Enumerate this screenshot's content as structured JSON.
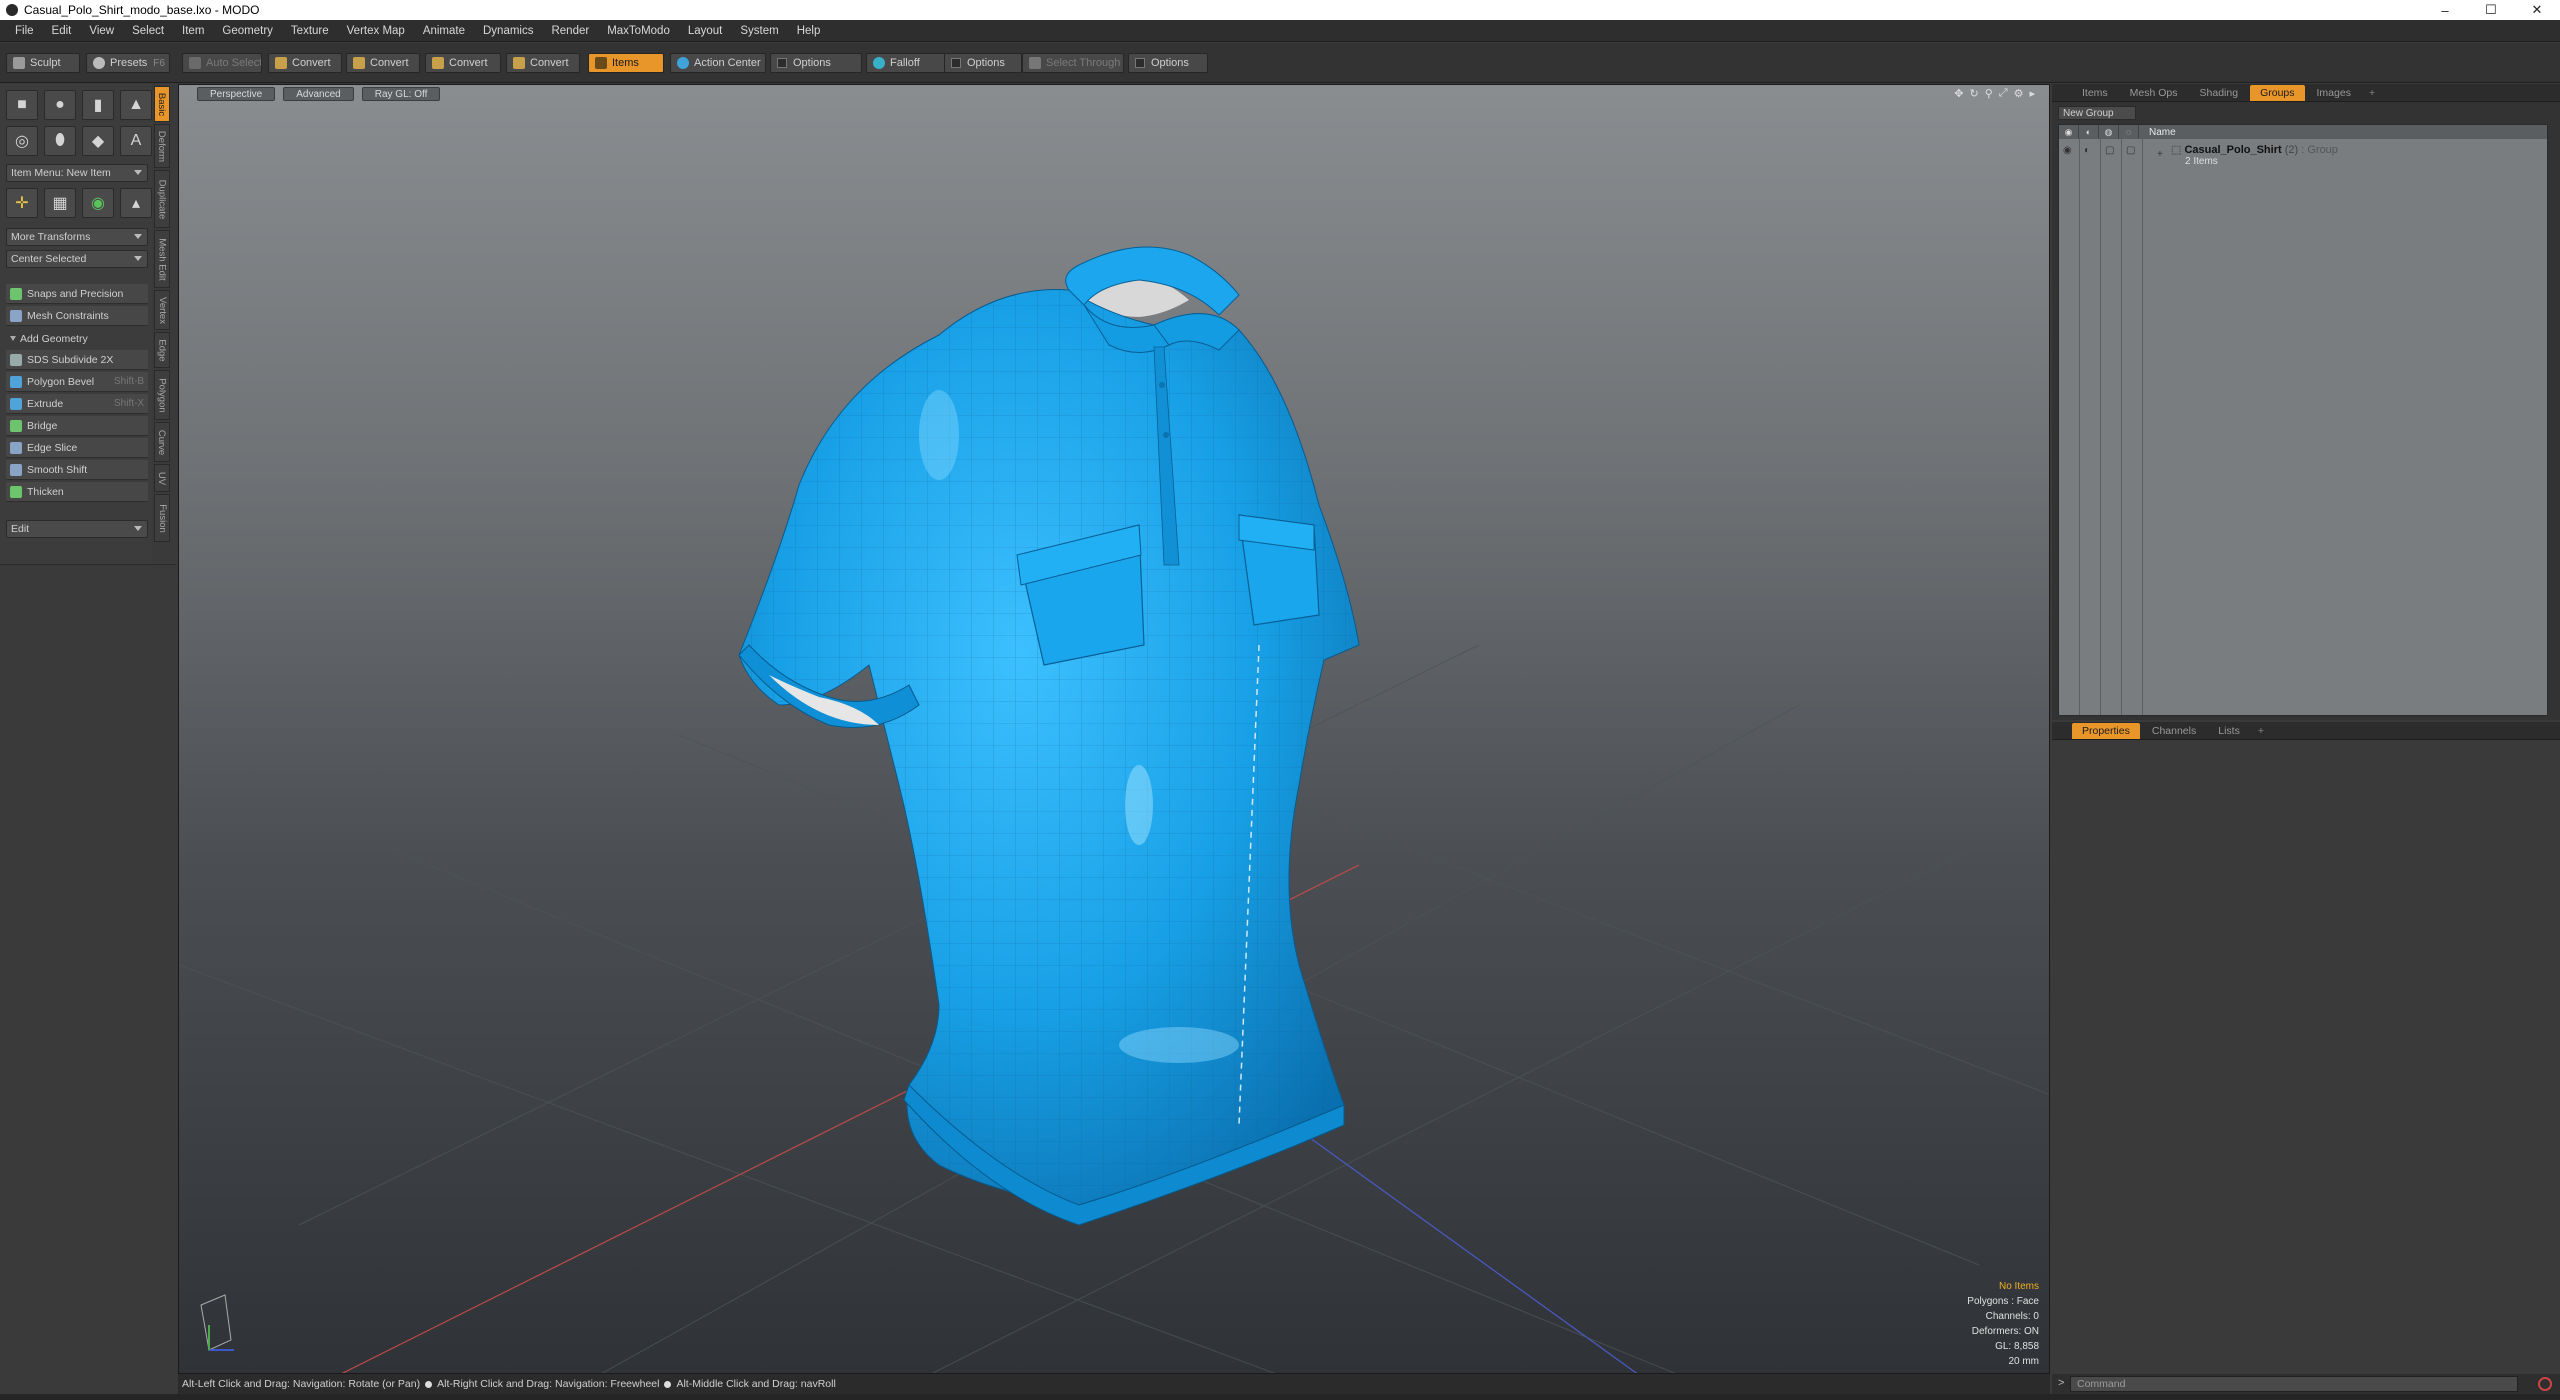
{
  "window": {
    "title": "Casual_Polo_Shirt_modo_base.lxo - MODO",
    "controls": [
      "–",
      "☐",
      "✕"
    ]
  },
  "menu": [
    "File",
    "Edit",
    "View",
    "Select",
    "Item",
    "Geometry",
    "Texture",
    "Vertex Map",
    "Animate",
    "Dynamics",
    "Render",
    "MaxToModo",
    "Layout",
    "System",
    "Help"
  ],
  "toolbar": {
    "sculpt": "Sculpt",
    "presets": "Presets",
    "presets_key": "F6",
    "auto_select": "Auto Select",
    "convert1": "Convert",
    "convert2": "Convert",
    "convert3": "Convert",
    "convert4": "Convert",
    "items": "Items",
    "action_center": "Action Center",
    "options1": "Options",
    "falloff": "Falloff",
    "options2": "Options",
    "select_through": "Select Through",
    "options3": "Options"
  },
  "toolbox": {
    "item_menu": "Item Menu: New Item",
    "more_transforms": "More Transforms",
    "center_selected": "Center Selected",
    "snaps": "Snaps and Precision",
    "mesh_constraints": "Mesh Constraints",
    "add_geometry": "Add Geometry",
    "tools": [
      {
        "label": "SDS Subdivide 2X",
        "shortcut": ""
      },
      {
        "label": "Polygon Bevel",
        "shortcut": "Shift-B"
      },
      {
        "label": "Extrude",
        "shortcut": "Shift-X"
      },
      {
        "label": "Bridge",
        "shortcut": ""
      },
      {
        "label": "Edge Slice",
        "shortcut": ""
      },
      {
        "label": "Smooth Shift",
        "shortcut": ""
      },
      {
        "label": "Thicken",
        "shortcut": ""
      }
    ],
    "edit_dropdown": "Edit"
  },
  "vertical_tabs": [
    "Basic",
    "Deform",
    "Duplicate",
    "Mesh Edit",
    "Vertex",
    "Edge",
    "Polygon",
    "Curve",
    "UV",
    "Fusion"
  ],
  "viewport": {
    "tabs": [
      "Perspective",
      "Advanced",
      "Ray GL: Off"
    ],
    "info": {
      "no_items": "No Items",
      "polygons": "Polygons : Face",
      "channels": "Channels: 0",
      "deformers": "Deformers: ON",
      "gl": "GL: 8,858",
      "scale": "20 mm"
    },
    "shirt_color": "#1aa3e8"
  },
  "statusbar": {
    "hint1": "Alt-Left Click and Drag: Navigation: Rotate (or Pan)",
    "hint2": "Alt-Right Click and Drag: Navigation: Freewheel",
    "hint3": "Alt-Middle Click and Drag: navRoll"
  },
  "right_top": {
    "tabs": [
      "Items",
      "Mesh Ops",
      "Shading",
      "Groups",
      "Images",
      "+"
    ],
    "active_tab": "Groups",
    "new_group": "New Group",
    "name_col": "Name",
    "group": {
      "name": "Casual_Polo_Shirt",
      "count": "(2)",
      "type": ": Group",
      "sub": "2 Items"
    }
  },
  "right_bottom": {
    "tabs": [
      "Properties",
      "Channels",
      "Lists",
      "+"
    ],
    "active_tab": "Properties"
  },
  "command": {
    "prompt": ">",
    "placeholder": "Command"
  },
  "colors": {
    "accent": "#e8952a",
    "shirt": "#1aa3e8"
  }
}
